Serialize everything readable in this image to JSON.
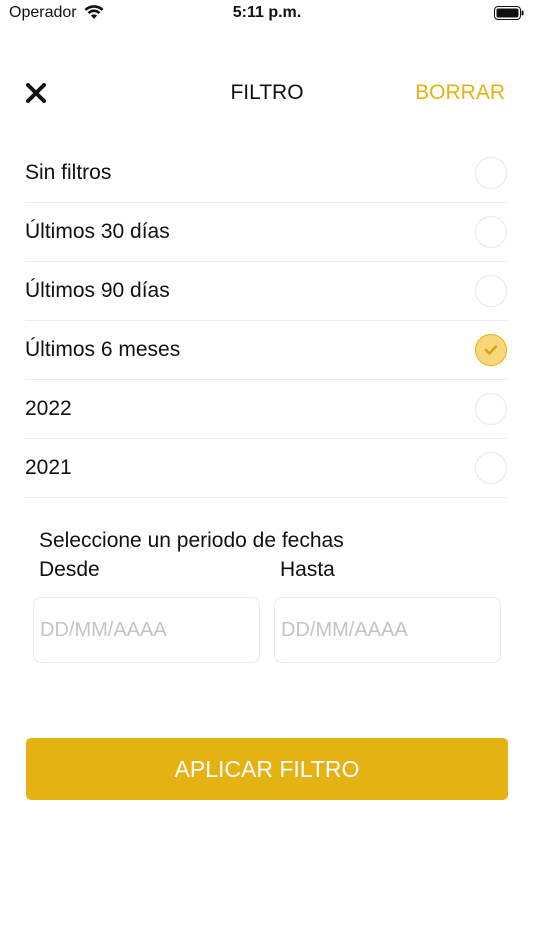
{
  "status_bar": {
    "carrier": "Operador",
    "time": "5:11 p.m."
  },
  "header": {
    "title": "FILTRO",
    "clear_label": "BORRAR"
  },
  "options": [
    {
      "label": "Sin filtros",
      "selected": false
    },
    {
      "label": "Últimos 30 días",
      "selected": false
    },
    {
      "label": "Últimos 90 días",
      "selected": false
    },
    {
      "label": "Últimos 6 meses",
      "selected": true
    },
    {
      "label": "2022",
      "selected": false
    },
    {
      "label": "2021",
      "selected": false
    }
  ],
  "date_range": {
    "title": "Seleccione un periodo de fechas",
    "from_label": "Desde",
    "to_label": "Hasta",
    "from_placeholder": "DD/MM/AAAA",
    "to_placeholder": "DD/MM/AAAA"
  },
  "apply_label": "APLICAR FILTRO",
  "colors": {
    "accent": "#E5B214",
    "selected_fill": "#F8D77A"
  },
  "icons": {
    "close": "close-icon",
    "check": "check-icon",
    "wifi": "wifi-icon",
    "battery": "battery-icon"
  }
}
